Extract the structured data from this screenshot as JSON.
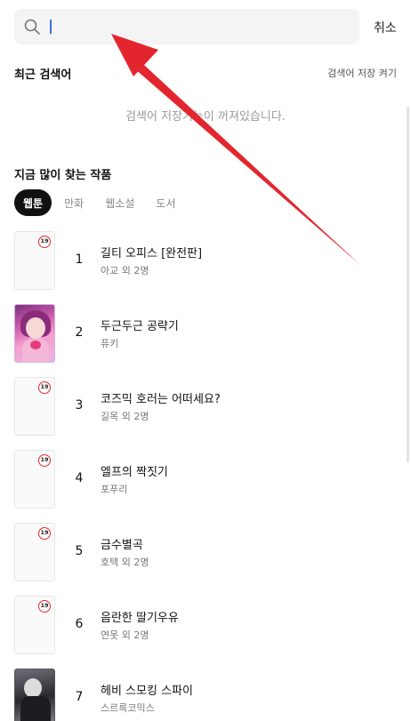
{
  "search": {
    "value": "",
    "placeholder": "",
    "cancel_label": "취소"
  },
  "recent": {
    "title": "최근 검색어",
    "toggle_label": "검색어 저장 켜기",
    "empty_message": "검색어 저장기능이 꺼져있습니다."
  },
  "popular": {
    "title": "지금 많이 찾는 작품",
    "tabs": [
      {
        "label": "웹툰",
        "active": true
      },
      {
        "label": "만화",
        "active": false
      },
      {
        "label": "웹소설",
        "active": false
      },
      {
        "label": "도서",
        "active": false
      }
    ],
    "items": [
      {
        "rank": "1",
        "title": "길티 오피스 [완전판]",
        "author": "아교 외 2명",
        "badge": "19"
      },
      {
        "rank": "2",
        "title": "두근두근 공략기",
        "author": "퓨키",
        "badge": ""
      },
      {
        "rank": "3",
        "title": "코즈믹 호러는 어떠세요?",
        "author": "길목 외 2명",
        "badge": "19"
      },
      {
        "rank": "4",
        "title": "엘프의 짝짓기",
        "author": "포푸리",
        "badge": "19"
      },
      {
        "rank": "5",
        "title": "금수별곡",
        "author": "호택 외 2명",
        "badge": "19"
      },
      {
        "rank": "6",
        "title": "음란한 딸기우유",
        "author": "연못 외 2명",
        "badge": "19"
      },
      {
        "rank": "7",
        "title": "헤비 스모킹 스파이",
        "author": "스르륵코믹스",
        "badge": ""
      }
    ]
  },
  "colors": {
    "accent": "#111111",
    "badge_border": "#e0282e",
    "annotation_arrow": "#e3262e"
  }
}
